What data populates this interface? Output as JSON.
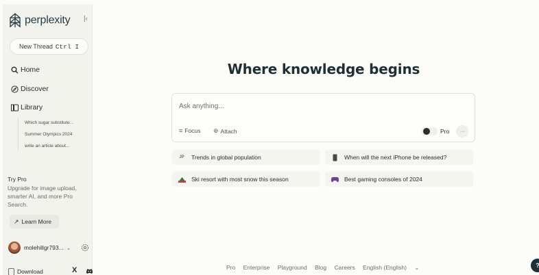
{
  "brand": {
    "name": "perplexity",
    "accent": "#1f3b45"
  },
  "sidebar": {
    "new_thread_label": "New Thread",
    "new_thread_shortcut": "Ctrl I",
    "nav": [
      {
        "label": "Home",
        "icon": "search-icon"
      },
      {
        "label": "Discover",
        "icon": "compass-icon"
      },
      {
        "label": "Library",
        "icon": "library-icon"
      }
    ],
    "library_items": [
      "Which sugar substitute...",
      "Summer Olympics 2024",
      "write an article about..."
    ],
    "try_pro": {
      "title": "Try Pro",
      "description": "Upgrade for image upload, smarter AI, and more Pro Search.",
      "button": "Learn More"
    },
    "user": {
      "name": "molehillgr793..."
    },
    "download_label": "Download"
  },
  "main": {
    "title": "Where knowledge begins",
    "ask": {
      "placeholder": "Ask anything...",
      "focus_label": "Focus",
      "attach_label": "Attach",
      "pro_label": "Pro",
      "pro_enabled": false
    },
    "suggestions": [
      {
        "label": "Trends in global population",
        "icon": "JP"
      },
      {
        "label": "When will the next iPhone be released?",
        "icon": "phone-icon"
      },
      {
        "label": "Ski resort with most snow this season",
        "icon": "ski-icon"
      },
      {
        "label": "Best gaming consoles of 2024",
        "icon": "gamepad-icon"
      }
    ]
  },
  "footer": {
    "links": [
      "Pro",
      "Enterprise",
      "Playground",
      "Blog",
      "Careers",
      "English (English)"
    ]
  },
  "help_label": "?"
}
